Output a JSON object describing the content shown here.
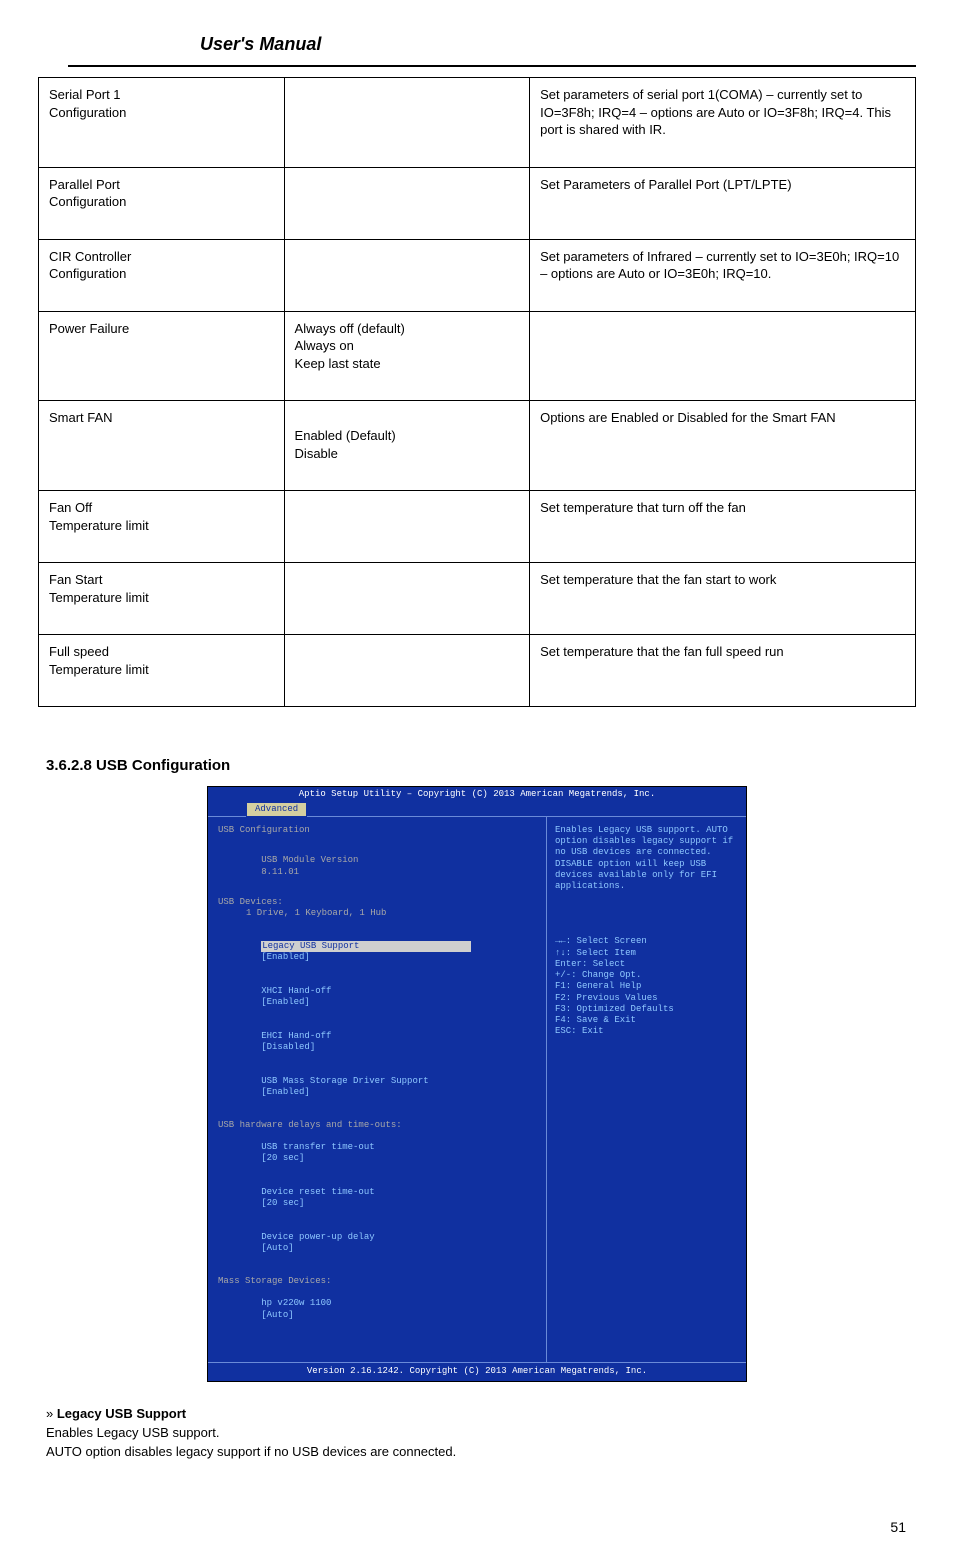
{
  "header": {
    "title": "User's Manual"
  },
  "table": {
    "rows": [
      {
        "feature_line1": "Serial Port 1",
        "feature_line2": "Configuration",
        "option": "",
        "desc": "Set parameters of serial port 1(COMA) – currently set to IO=3F8h; IRQ=4 – options are Auto or IO=3F8h; IRQ=4. This port is shared with IR."
      },
      {
        "feature_line1": "Parallel Port",
        "feature_line2": "Configuration",
        "option": "",
        "desc": "Set Parameters of Parallel Port (LPT/LPTE)"
      },
      {
        "feature_line1": "CIR Controller",
        "feature_line2": "Configuration",
        "option": "",
        "desc": "Set parameters of Infrared – currently set to IO=3E0h; IRQ=10 – options are Auto or IO=3E0h; IRQ=10."
      },
      {
        "feature": "Power Failure",
        "opt_line1": "Always off (default)",
        "opt_line2": "Always on",
        "opt_line3": "Keep last state",
        "desc": ""
      },
      {
        "feature": "Smart FAN",
        "option": "Enabled (Default)\nDisable",
        "desc": "Options are Enabled or Disabled for the Smart FAN"
      },
      {
        "feature_line1": "Fan Off",
        "feature_line2": "Temperature limit",
        "option": "",
        "desc": "Set temperature that turn off the fan"
      },
      {
        "feature_line1": "Fan Start",
        "feature_line2": "Temperature limit",
        "option": "",
        "desc": "Set temperature that the fan start to work"
      },
      {
        "feature_line1": "Full speed",
        "feature_line2": "Temperature limit",
        "option": "",
        "desc": "Set temperature that the fan full speed run"
      }
    ]
  },
  "section_heading": "3.6.2.8 USB Configuration",
  "bios": {
    "top_title": "Aptio Setup Utility – Copyright (C) 2013 American Megatrends, Inc.",
    "tab": "Advanced",
    "left": {
      "heading": "USB Configuration",
      "module_label": "USB Module Version",
      "module_val": "8.11.01",
      "devices_label": "USB Devices:",
      "devices_val": "1 Drive, 1 Keyboard, 1 Hub",
      "items": [
        {
          "label": "Legacy USB Support",
          "val": "[Enabled]",
          "hl": true
        },
        {
          "label": "XHCI Hand-off",
          "val": "[Enabled]"
        },
        {
          "label": "EHCI Hand-off",
          "val": "[Disabled]"
        },
        {
          "label": "USB Mass Storage Driver Support",
          "val": "[Enabled]"
        }
      ],
      "timeouts_head": "USB hardware delays and time-outs:",
      "timeouts": [
        {
          "label": "USB transfer time-out",
          "val": "[20 sec]"
        },
        {
          "label": "Device reset time-out",
          "val": "[20 sec]"
        },
        {
          "label": "Device power-up delay",
          "val": "[Auto]"
        }
      ],
      "mass_head": "Mass Storage Devices:",
      "mass": [
        {
          "label": "hp v220w 1100",
          "val": "[Auto]"
        }
      ]
    },
    "right": {
      "help": "Enables Legacy USB support. AUTO option disables legacy support if no USB devices are connected. DISABLE option will keep USB devices available only for EFI applications.",
      "keys": [
        "→←: Select Screen",
        "↑↓: Select Item",
        "Enter: Select",
        "+/-: Change Opt.",
        "F1: General Help",
        "F2: Previous Values",
        "F3: Optimized Defaults",
        "F4: Save & Exit",
        "ESC: Exit"
      ]
    },
    "footer": "Version 2.16.1242. Copyright (C) 2013 American Megatrends, Inc."
  },
  "desc": {
    "bullet_label": "Legacy USB Support",
    "body_line1": "Enables Legacy USB support.",
    "body_line2": "AUTO option disables legacy support if no USB devices are connected."
  },
  "page_number": "51"
}
